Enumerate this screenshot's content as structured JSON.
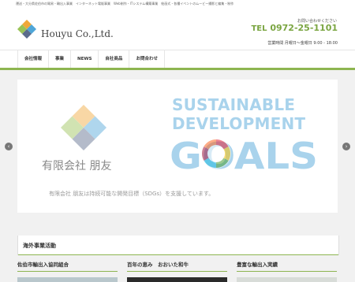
{
  "topbar": {
    "text": "運送・大分県佐伯市の貿易・輸出入事業　インターネット電販事業　Web制作・ITシステム構築事業　絵画式・各種イベントのムービー撮影と編集・制作"
  },
  "header": {
    "brand": "Houyu Co.,Ltd.",
    "contact_label": "お問い合わせください",
    "tel_prefix": "TEL",
    "tel_number": "0972-25-1101",
    "hours": "営業時間 月曜日～金曜日 9:00 - 18:00"
  },
  "nav": {
    "items": [
      {
        "label": "会社情報"
      },
      {
        "label": "事業"
      },
      {
        "label": "NEWS"
      },
      {
        "label": "自社商品"
      },
      {
        "label": "お問合わせ"
      }
    ]
  },
  "slider": {
    "company_name": "有限会社 朋友",
    "sdgs_line1": "SUSTAINABLE",
    "sdgs_line2": "DEVELOPMENT",
    "sdgs_line3": "GOALS",
    "caption": "有限会社 朋友は持続可能な開発目標（SDGs）を支援しています。",
    "prev_label": "‹",
    "next_label": "›"
  },
  "main": {
    "section_title": "海外事業活動",
    "columns": [
      {
        "title": "佐伯市輸出入協同組合"
      },
      {
        "title": "百年の恵み　おおいた和牛"
      },
      {
        "title": "豊富な輸出入実績"
      }
    ]
  },
  "colors": {
    "accent": "#8db550",
    "tel": "#7aa541",
    "sdgs": "#a9d3ec"
  },
  "icons": {
    "logo": "diamond-logo-icon",
    "prev": "chevron-left-icon",
    "next": "chevron-right-icon"
  }
}
